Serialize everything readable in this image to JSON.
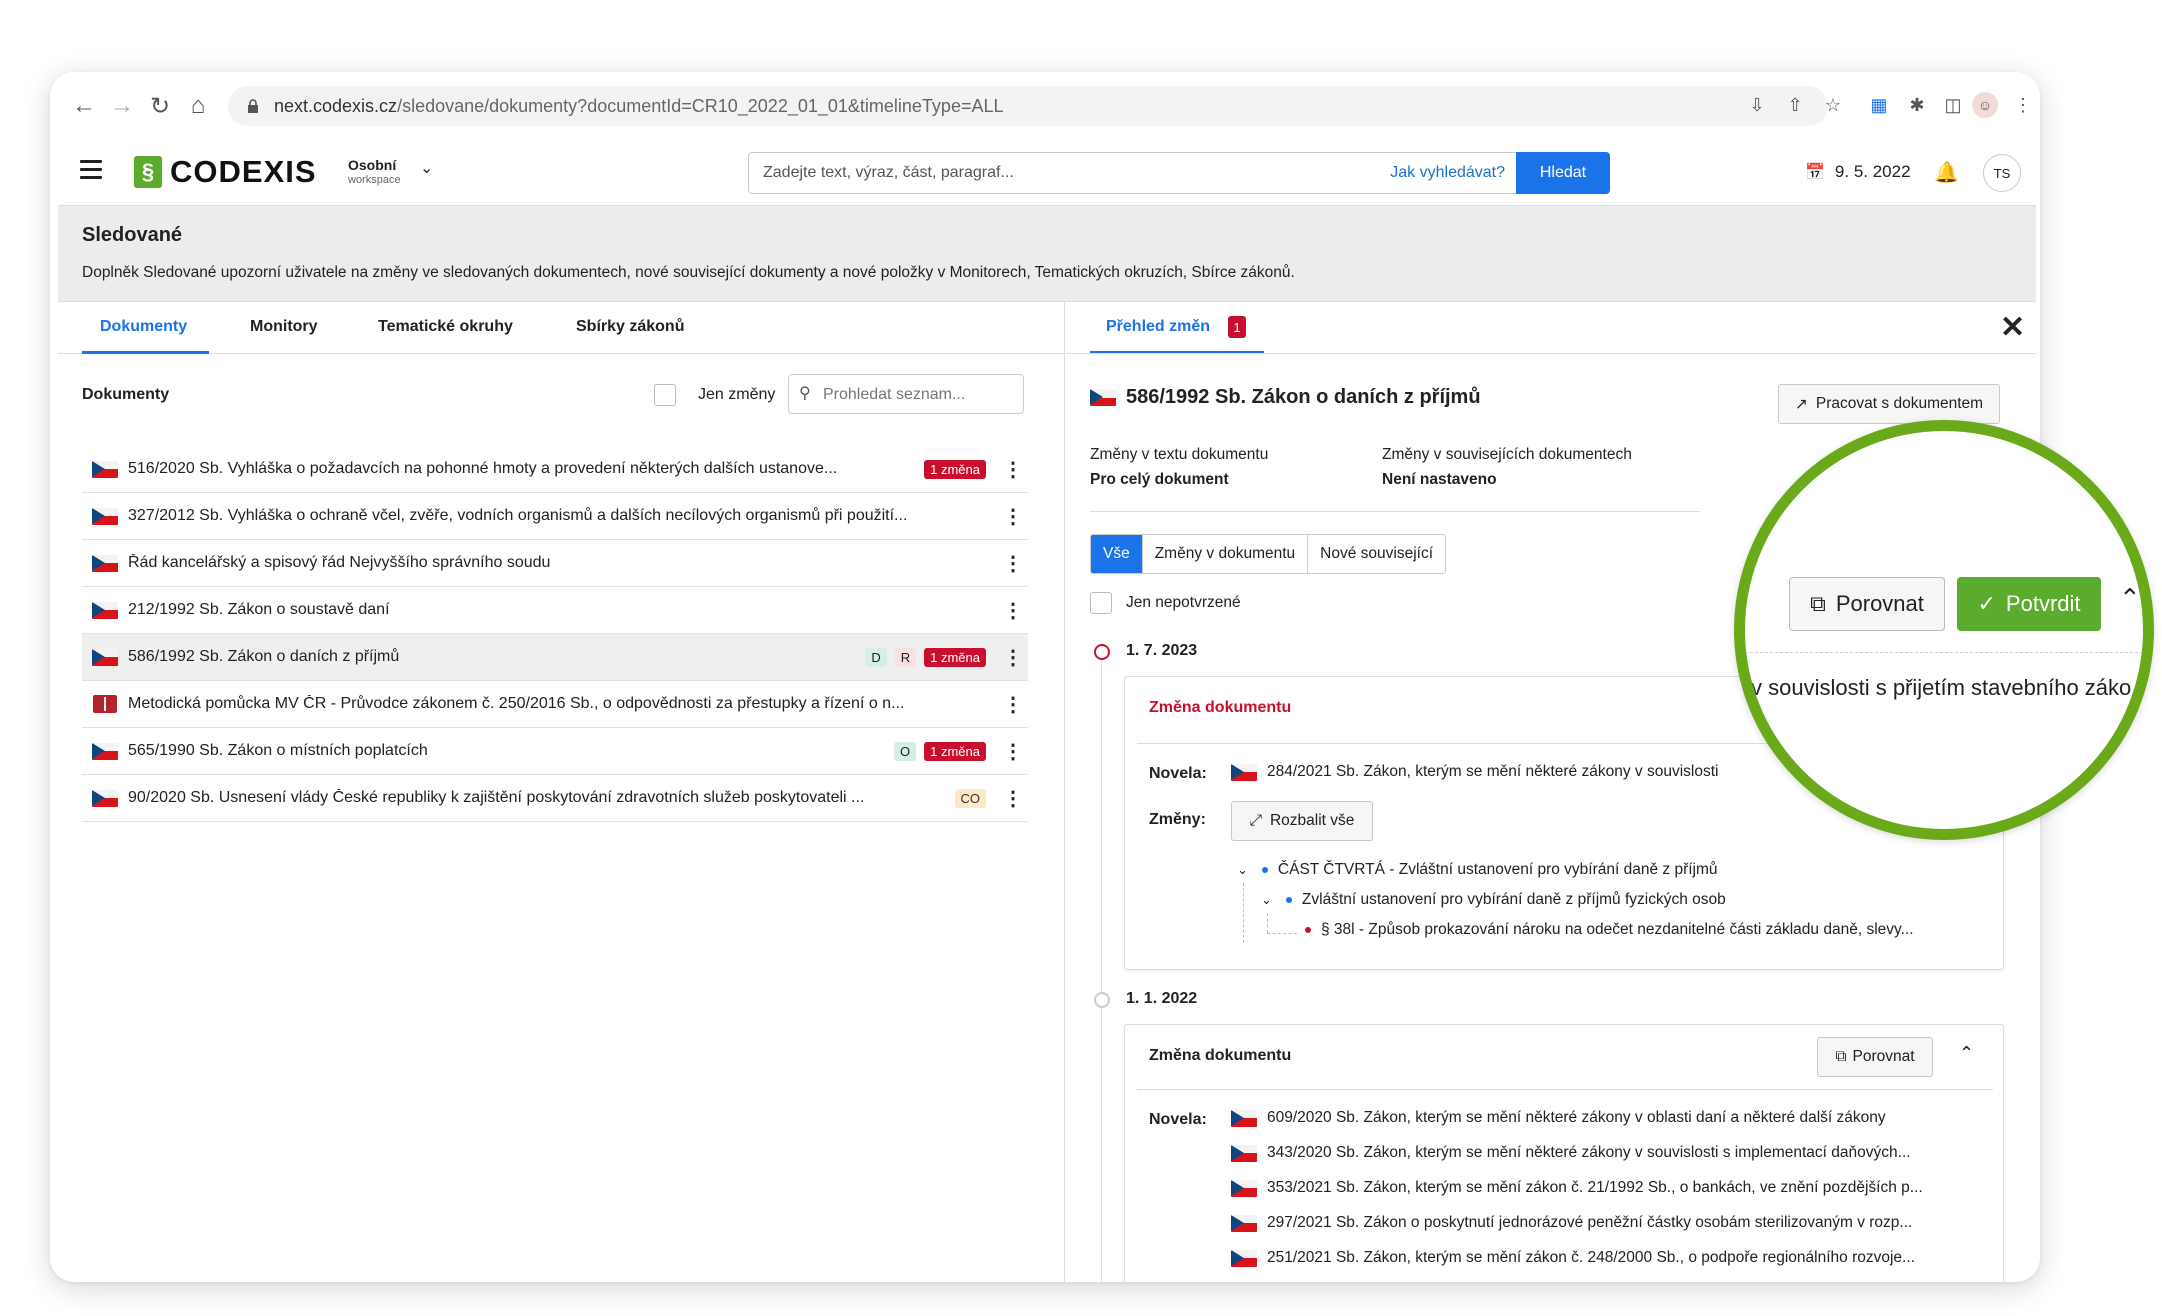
{
  "browser": {
    "url_host": "next.codexis.cz",
    "url_path": "/sledovane/dokumenty?documentId=CR10_2022_01_01&timelineType=ALL"
  },
  "header": {
    "logo_text": "CODEXIS",
    "logo_mark": "§",
    "workspace_name": "Osobní",
    "workspace_sub": "workspace",
    "search_placeholder": "Zadejte text, výraz, část, paragraf...",
    "search_help": "Jak vyhledávat?",
    "search_button": "Hledat",
    "date": "9. 5. 2022",
    "avatar": "TS"
  },
  "banner": {
    "title": "Sledované",
    "description": "Doplněk Sledované upozorní uživatele na změny ve sledovaných dokumentech, nové související dokumenty a nové položky v Monitorech, Tematických okruzích, Sbírce zákonů."
  },
  "left": {
    "tabs": [
      "Dokumenty",
      "Monitory",
      "Tematické okruhy",
      "Sbírky zákonů"
    ],
    "heading": "Dokumenty",
    "only_changes": "Jen změny",
    "filter_placeholder": "Prohledat seznam...",
    "documents": [
      {
        "icon": "czech-flag-icon",
        "title": "516/2020 Sb. Vyhláška o požadavcích na pohonné hmoty a provedení některých dalších ustanove...",
        "badges": [
          {
            "type": "red",
            "text": "1 změna"
          }
        ]
      },
      {
        "icon": "czech-flag-icon",
        "title": "327/2012 Sb. Vyhláška o ochraně včel, zvěře, vodních organismů a dalších necílových organismů při použití...",
        "badges": []
      },
      {
        "icon": "czech-flag-icon",
        "title": "Řád kancelářský a spisový řád Nejvyššího správního soudu",
        "badges": []
      },
      {
        "icon": "czech-flag-icon",
        "title": "212/1992 Sb. Zákon o soustavě daní",
        "badges": []
      },
      {
        "icon": "czech-flag-icon",
        "title": "586/1992 Sb. Zákon o daních z příjmů",
        "badges": [
          {
            "type": "d",
            "text": "D"
          },
          {
            "type": "r",
            "text": "R"
          },
          {
            "type": "red",
            "text": "1 změna"
          }
        ]
      },
      {
        "icon": "book-icon",
        "title": "Metodická pomůcka MV ČR - Průvodce zákonem č. 250/2016 Sb., o odpovědnosti za přestupky a řízení o n...",
        "badges": []
      },
      {
        "icon": "czech-flag-icon",
        "title": "565/1990 Sb. Zákon o místních poplatcích",
        "badges": [
          {
            "type": "o",
            "text": "O"
          },
          {
            "type": "red",
            "text": "1 změna"
          }
        ]
      },
      {
        "icon": "czech-flag-icon",
        "title": "90/2020 Sb. Usnesení vlády České republiky k zajištění poskytování zdravotních služeb poskytovateli ...",
        "badges": [
          {
            "type": "co",
            "text": "CO"
          }
        ]
      }
    ]
  },
  "right": {
    "tab_label": "Přehled změn",
    "tab_count": "1",
    "doc_title": "586/1992 Sb. Zákon o daních z příjmů",
    "work_button": "Pracovat s dokumentem",
    "meta_text_label": "Změny v textu dokumentu",
    "meta_text_value": "Pro celý dokument",
    "meta_related_label": "Změny v souvisejících dokumentech",
    "meta_related_value": "Není nastaveno",
    "segments": [
      "Vše",
      "Změny v dokumentu",
      "Nové související"
    ],
    "only_unconfirmed": "Jen nepotvrzené",
    "timeline": [
      {
        "date": "1. 7. 2023",
        "card_title": "Změna dokumentu",
        "novela_label": "Novela:",
        "novely": [
          "284/2021 Sb. Zákon, kterým se mění některé zákony v souvislosti"
        ],
        "changes_label": "Změny:",
        "expand_button": "Rozbalit vše",
        "tree": [
          "ČÁST ČTVRTÁ - Zvláštní ustanovení pro vybírání daně z příjmů",
          "Zvláštní ustanovení pro vybírání daně z příjmů fyzických osob",
          "§ 38l - Způsob prokazování nároku na odečet nezdanitelné části základu daně, slevy..."
        ]
      },
      {
        "date": "1. 1. 2022",
        "card_title": "Změna dokumentu",
        "compare_button": "Porovnat",
        "novela_label": "Novela:",
        "novely": [
          "609/2020 Sb. Zákon, kterým se mění některé zákony v oblasti daní a některé další zákony",
          "343/2020 Sb. Zákon, kterým se mění některé zákony v souvislosti s implementací daňových...",
          "353/2021 Sb. Zákon, kterým se mění zákon č. 21/1992 Sb., o bankách, ve znění pozdějších p...",
          "297/2021 Sb. Zákon o poskytnutí jednorázové peněžní částky osobám sterilizovaným v rozp...",
          "251/2021 Sb. Zákon, kterým se mění zákon č. 248/2000 Sb., o podpoře regionálního rozvoje..."
        ]
      }
    ]
  },
  "zoom": {
    "compare_button": "Porovnat",
    "confirm_button": "Potvrdit",
    "text": "v souvislosti s přijetím stavebního záko"
  },
  "colors": {
    "accent_blue": "#1a73e8",
    "brand_green": "#5aab2e",
    "zoom_ring": "#6aaa1a",
    "badge_red": "#c8102e"
  }
}
